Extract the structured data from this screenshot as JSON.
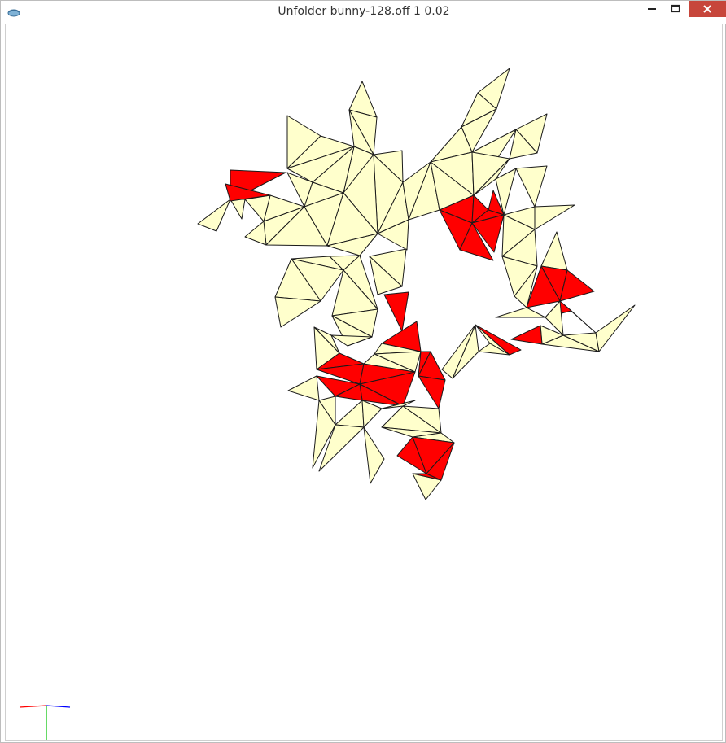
{
  "window": {
    "title": "Unfolder bunny-128.off 1 0.02",
    "icons": {
      "app": "ogre-app-icon",
      "minimize": "minimize-icon",
      "maximize": "maximize-icon",
      "close": "close-icon"
    }
  },
  "colors": {
    "titlebar_bg": "#ffffff",
    "close_bg": "#c7463b",
    "face_default": "#ffffcc",
    "face_highlight": "#ff0000",
    "edge": "#1a1a1a",
    "axis_x": "#ff0000",
    "axis_y": "#00c000",
    "axis_z": "#0000ff"
  }
}
